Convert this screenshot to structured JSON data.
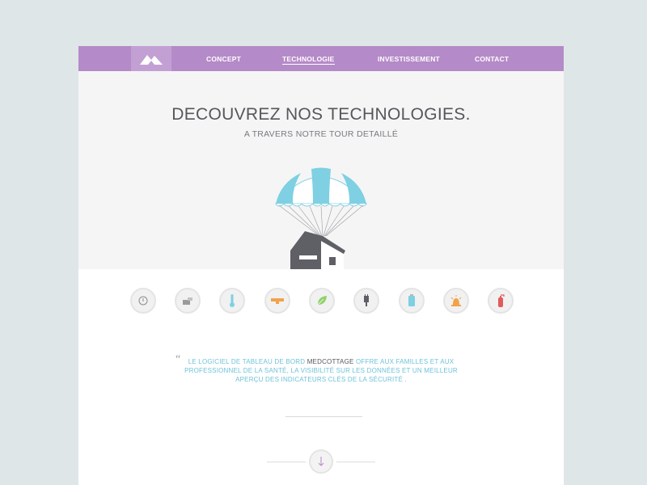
{
  "nav": {
    "items": [
      {
        "label": "CONCEPT"
      },
      {
        "label": "TECHNOLOGIE"
      },
      {
        "label": "INVESTISSEMENT"
      },
      {
        "label": "CONTACT"
      }
    ]
  },
  "hero": {
    "title": "DECOUVREZ NOS TECHNOLOGIES.",
    "subtitle": "A TRAVERS NOTRE TOUR DETAILLÉ"
  },
  "tech_icons": [
    "thermostat-icon",
    "camera-icon",
    "thermometer-icon",
    "alarm-sensor-icon",
    "leaf-icon",
    "plug-icon",
    "water-tank-icon",
    "siren-icon",
    "fire-extinguisher-icon"
  ],
  "quote": {
    "part1": "LE LOGICIEL DE TABLEAU DE BORD ",
    "brand": "MEDCOTTAGE",
    "part2": " OFFRE AUX FAMILLES ET AUX PROFESSIONNEL DE LA SANTÉ, LA VISIBILITÉ SUR LES DONNÉES ET UN MEILLEUR APERÇU DES INDICATEURS CLÉS DE LA SÉCURITÉ ."
  },
  "colors": {
    "nav_bg": "#b58ac8",
    "accent": "#6ec3d8",
    "parachute_blue": "#7ed0e2",
    "house_gray": "#5e6066"
  }
}
